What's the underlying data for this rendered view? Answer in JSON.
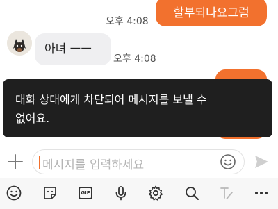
{
  "messages": {
    "outgoing_1": {
      "text": "할부되나요그럼",
      "time": "오후 4:08"
    },
    "incoming_1": {
      "text": "아녀 ㅡㅡ",
      "time": "오후 4:08"
    }
  },
  "toast": {
    "line1": "대화 상대에게 차단되어 메시지를 보낼 수",
    "line2": "없어요."
  },
  "composer": {
    "placeholder": "메시지를 입력하세요"
  },
  "toolbar": {
    "gif_label": "GIF",
    "icons": [
      "emoji-icon",
      "sticker-icon",
      "gif-icon",
      "microphone-icon",
      "settings-gear-icon",
      "search-icon",
      "text-style-icon",
      "more-icon"
    ]
  },
  "colors": {
    "accent": "#f2712e",
    "incoming_bubble": "#efeff1",
    "toast_bg": "#1f1f1f"
  }
}
